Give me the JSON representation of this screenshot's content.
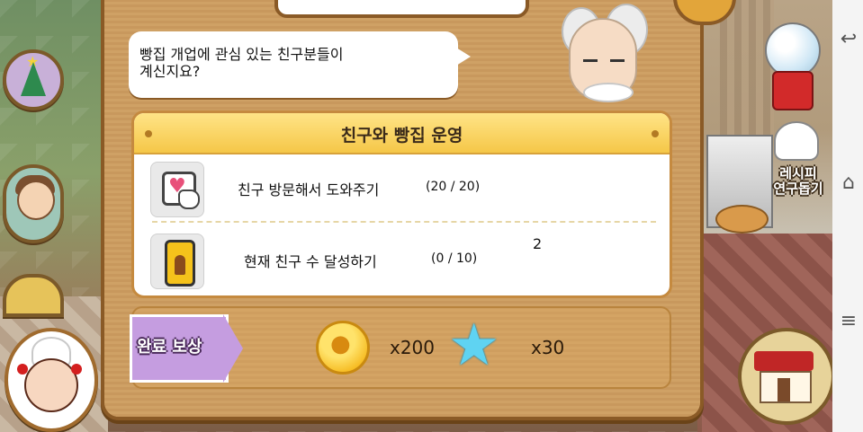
{
  "dialog": {
    "speech": [
      "빵집 개업에 관심 있는 친구분들이",
      "계신지요?"
    ],
    "quest_title": "친구와 빵집 운영",
    "tasks": [
      {
        "label": "친구 방문해서 도와주기",
        "progress": "(20 / 20)",
        "icon": "heart-hand-icon"
      },
      {
        "label": "현재 친구 수 달성하기",
        "progress": "(0 / 10)",
        "icon": "phone-person-icon"
      }
    ],
    "stray_text": "2",
    "reward": {
      "label": "완료 보상",
      "items": [
        {
          "icon": "gold-coin-icon",
          "amount": "x200"
        },
        {
          "icon": "blue-star-icon",
          "amount": "x30"
        }
      ]
    }
  },
  "side_right": {
    "recipe_label": [
      "레시피",
      "연구돕기"
    ]
  },
  "colors": {
    "panel": "#c99a5e",
    "header": "#f5c748",
    "ribbon": "#c59de0",
    "star": "#5fd3f2",
    "coin": "#f5b71a"
  }
}
